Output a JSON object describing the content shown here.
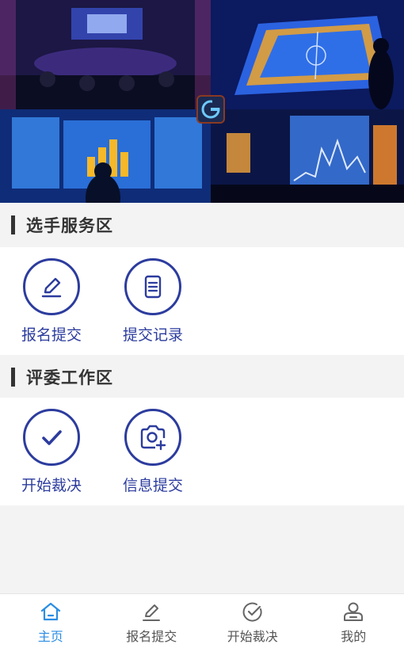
{
  "banner": {
    "logo_icon": "g-logo-icon"
  },
  "sections": [
    {
      "title": "选手服务区",
      "items": [
        {
          "label": "报名提交",
          "icon": "edit-pen-icon"
        },
        {
          "label": "提交记录",
          "icon": "document-icon"
        }
      ]
    },
    {
      "title": "评委工作区",
      "items": [
        {
          "label": "开始裁决",
          "icon": "checkmark-icon"
        },
        {
          "label": "信息提交",
          "icon": "camera-plus-icon"
        }
      ]
    }
  ],
  "tabbar": {
    "tabs": [
      {
        "label": "主页",
        "icon": "home-icon",
        "active": true
      },
      {
        "label": "报名提交",
        "icon": "edit-pen-icon",
        "active": false
      },
      {
        "label": "开始裁决",
        "icon": "check-circle-icon",
        "active": false
      },
      {
        "label": "我的",
        "icon": "user-icon",
        "active": false
      }
    ]
  },
  "colors": {
    "accent": "#2c3c9e",
    "active_tab": "#2b8de3",
    "header_bar": "#333333"
  }
}
